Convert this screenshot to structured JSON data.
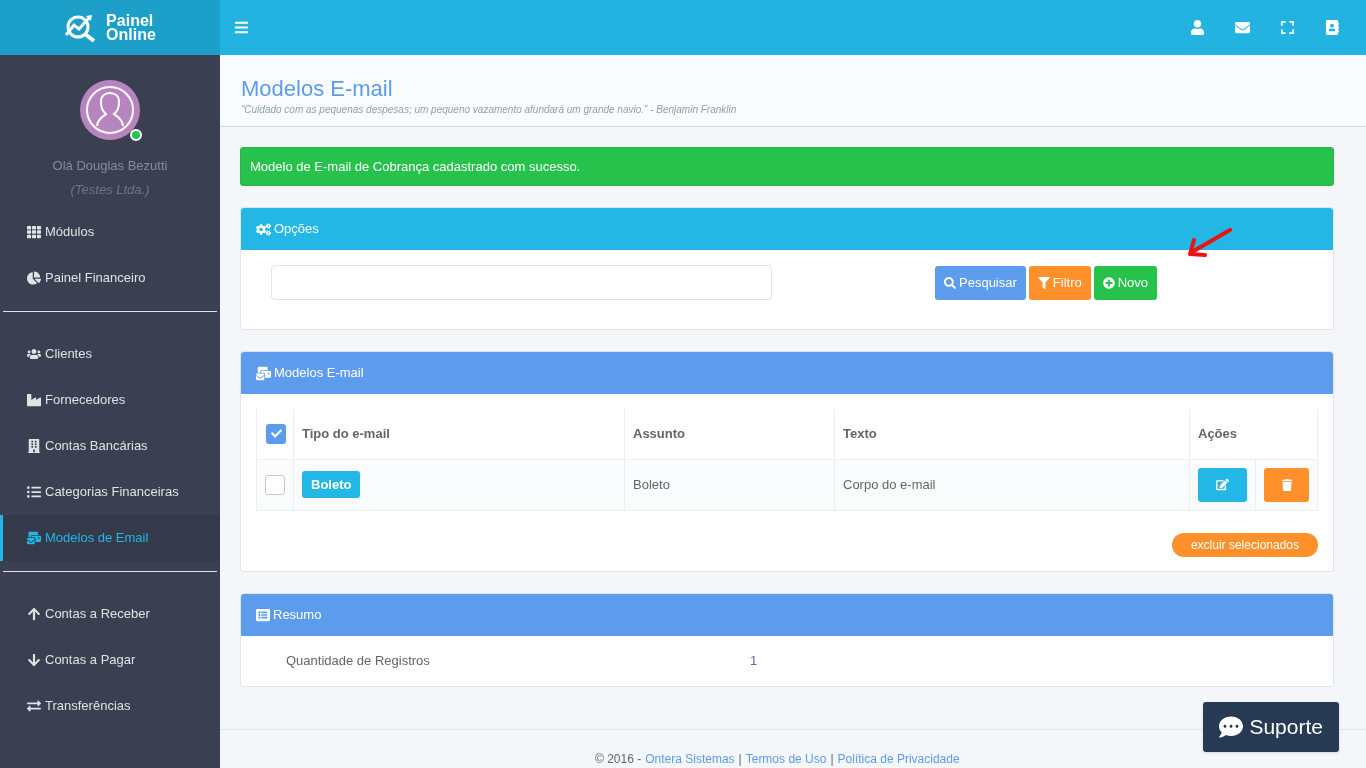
{
  "header": {
    "logo": {
      "line1": "Painel",
      "line2": "Online"
    }
  },
  "sidebar": {
    "user": {
      "greeting": "Olá Douglas Bezutti",
      "company": "(Testes Ltda.)",
      "online": true
    },
    "groups": [
      [
        {
          "label": "Módulos",
          "selected": false
        },
        {
          "label": "Painel Financeiro",
          "selected": false
        }
      ],
      [
        {
          "label": "Clientes",
          "selected": false
        },
        {
          "label": "Fornecedores",
          "selected": false
        },
        {
          "label": "Contas Bancárias",
          "selected": false
        },
        {
          "label": "Categorias Financeiras",
          "selected": false
        },
        {
          "label": "Modelos de Email",
          "selected": true
        }
      ],
      [
        {
          "label": "Contas a Receber",
          "selected": false
        },
        {
          "label": "Contas a Pagar",
          "selected": false
        },
        {
          "label": "Transferências",
          "selected": false
        }
      ]
    ]
  },
  "page": {
    "title": "Modelos E-mail",
    "quote": "“Cuidado com as pequenas despesas; um pequeno vazamento afundará um grande navio.” - Benjamin Franklin"
  },
  "alert": {
    "text": "Modelo de E-mail de Cobrança cadastrado com sucesso."
  },
  "options": {
    "title": "Opções",
    "buttons": [
      {
        "label": "Pesquisar",
        "kind": "search"
      },
      {
        "label": "Filtro",
        "kind": "filter"
      },
      {
        "label": "Novo",
        "kind": "new"
      }
    ]
  },
  "table_panel": {
    "title": "Modelos E-mail",
    "all_checked": true,
    "columns": [
      "Tipo do e-mail",
      "Assunto",
      "Texto",
      "Ações"
    ],
    "rows": [
      {
        "checked": false,
        "type": "Boleto",
        "subject": "Boleto",
        "text": "Corpo do e-mail"
      }
    ],
    "delete_selected": "excluir selecionados"
  },
  "summary": {
    "title": "Resumo",
    "rows": [
      {
        "label": "Quantidade de Registros",
        "value": "1"
      }
    ]
  },
  "support": {
    "label": "Suporte"
  },
  "footer": {
    "copyright": "© 2016 -",
    "separator": "|",
    "links": [
      "Ontera Sistemas",
      "Termos de Uso",
      "Política de Privacidade"
    ]
  }
}
